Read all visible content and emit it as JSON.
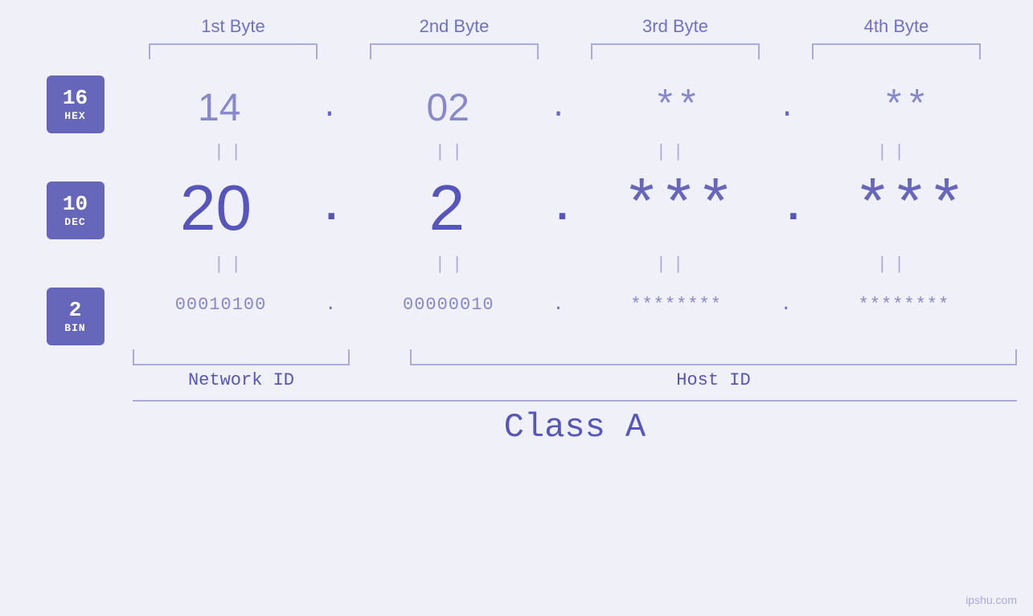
{
  "header": {
    "byte1": "1st Byte",
    "byte2": "2nd Byte",
    "byte3": "3rd Byte",
    "byte4": "4th Byte"
  },
  "badges": {
    "hex": {
      "number": "16",
      "label": "HEX"
    },
    "dec": {
      "number": "10",
      "label": "DEC"
    },
    "bin": {
      "number": "2",
      "label": "BIN"
    }
  },
  "hex_row": {
    "b1": "14",
    "b2": "02",
    "b3": "**",
    "b4": "**",
    "dot": "."
  },
  "dec_row": {
    "b1": "20",
    "b2": "2",
    "b3": "***",
    "b4": "***",
    "dot": "."
  },
  "bin_row": {
    "b1": "00010100",
    "b2": "00000010",
    "b3": "********",
    "b4": "********",
    "dot": "."
  },
  "labels": {
    "network_id": "Network ID",
    "host_id": "Host ID",
    "class": "Class A"
  },
  "watermark": "ipshu.com",
  "separator": "||"
}
